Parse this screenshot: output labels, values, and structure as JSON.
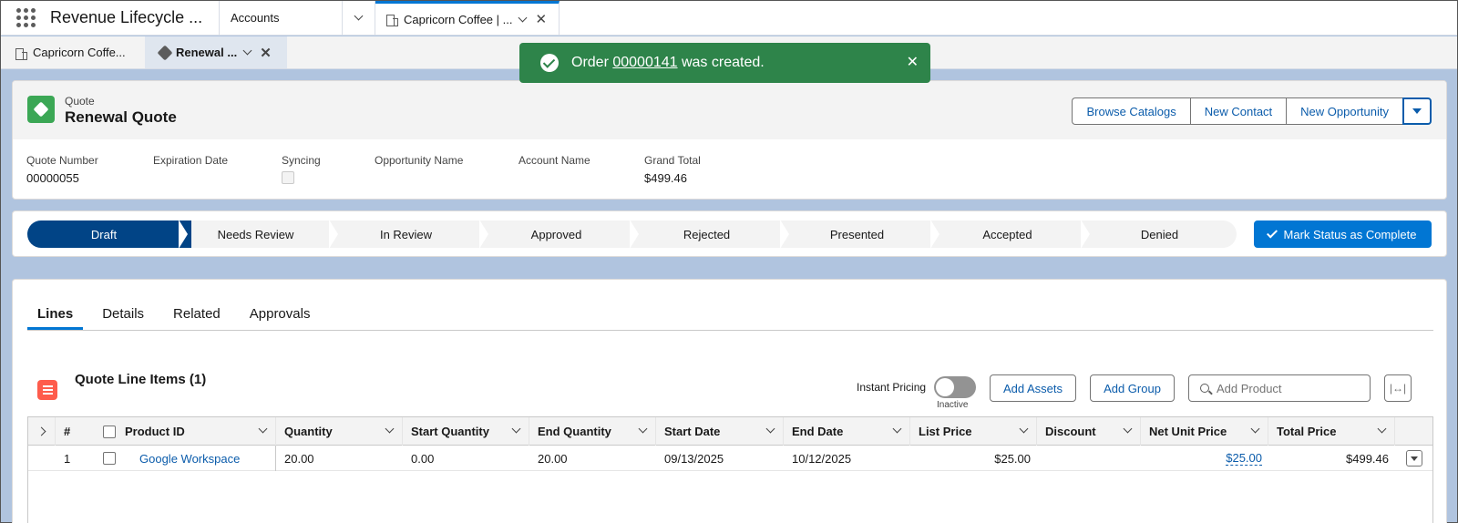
{
  "app": {
    "name": "Revenue Lifecycle ..."
  },
  "nav_tabs": {
    "accounts": "Accounts",
    "active": "Capricorn Coffee | ..."
  },
  "sub_tabs": [
    {
      "label": "Capricorn Coffe..."
    },
    {
      "label": "Renewal ..."
    }
  ],
  "toast": {
    "prefix": "Order ",
    "link": "00000141",
    "suffix": " was created.",
    "color": "#2e844a"
  },
  "record": {
    "object": "Quote",
    "name": "Renewal Quote",
    "actions": [
      "Browse Catalogs",
      "New Contact",
      "New Opportunity"
    ]
  },
  "fields": [
    {
      "label": "Quote Number",
      "value": "00000055"
    },
    {
      "label": "Expiration Date",
      "value": ""
    },
    {
      "label": "Syncing",
      "value": ""
    },
    {
      "label": "Opportunity Name",
      "value": ""
    },
    {
      "label": "Account Name",
      "value": ""
    },
    {
      "label": "Grand Total",
      "value": "$499.46"
    }
  ],
  "path": {
    "stages": [
      "Draft",
      "Needs Review",
      "In Review",
      "Approved",
      "Rejected",
      "Presented",
      "Accepted",
      "Denied"
    ],
    "current": "Draft",
    "mark_button": "Mark Status as Complete",
    "accent": "#014486"
  },
  "tabs": [
    "Lines",
    "Details",
    "Related",
    "Approvals"
  ],
  "lines": {
    "title": "Quote Line Items (1)",
    "instant_pricing_label": "Instant Pricing",
    "instant_pricing_state": "Inactive",
    "add_assets": "Add Assets",
    "add_group": "Add Group",
    "search_placeholder": "Add Product",
    "columns": [
      "#",
      "Product ID",
      "Quantity",
      "Start Quantity",
      "End Quantity",
      "Start Date",
      "End Date",
      "List Price",
      "Discount",
      "Net Unit Price",
      "Total Price"
    ],
    "rows": [
      {
        "num": "1",
        "product": "Google Workspace",
        "quantity": "20.00",
        "start_qty": "0.00",
        "end_qty": "20.00",
        "start_date": "09/13/2025",
        "end_date": "10/12/2025",
        "list_price": "$25.00",
        "discount": "",
        "net_unit_price": "$25.00",
        "total_price": "$499.46"
      }
    ]
  },
  "icons": [
    "app-launcher-icon",
    "account-icon",
    "chevron-down-icon",
    "close-icon",
    "tag-icon",
    "success-check-icon",
    "quote-icon",
    "dropdown-triangle-icon",
    "check-icon",
    "line-items-icon",
    "search-icon",
    "column-resize-icon"
  ]
}
